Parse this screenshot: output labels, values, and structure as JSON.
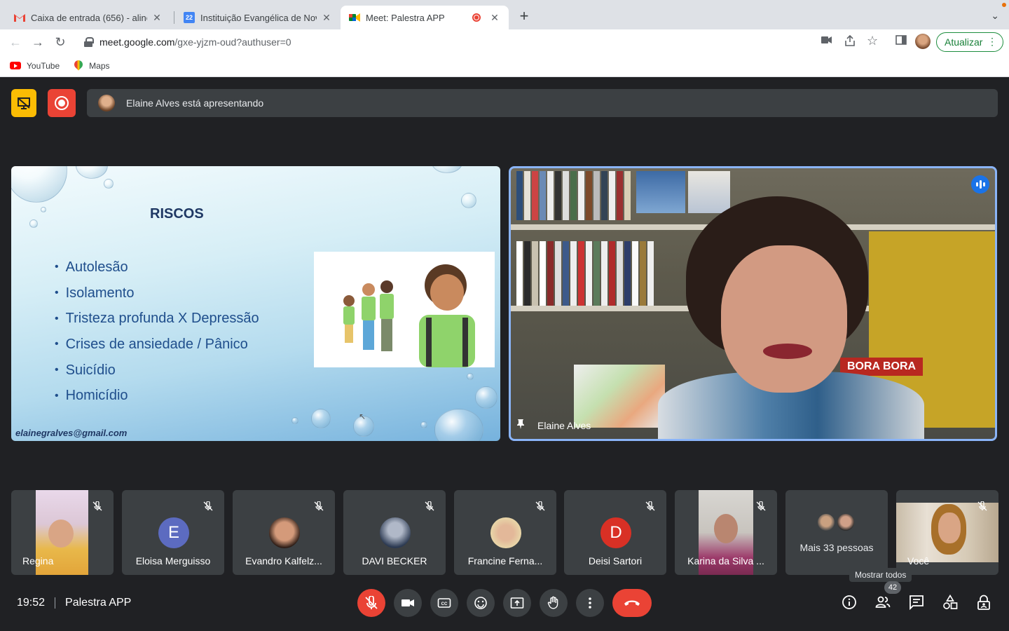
{
  "browser": {
    "tabs": [
      {
        "title": "Caixa de entrada (656) - aline.",
        "favicon": "gmail-icon"
      },
      {
        "title": "Instituição Evangélica de Novo",
        "favicon": "calendar-icon"
      },
      {
        "title": "Meet: Palestra APP",
        "favicon": "meet-icon"
      }
    ],
    "url_host": "meet.google.com",
    "url_path": "/gxe-yjzm-oud?authuser=0",
    "update_label": "Atualizar",
    "bookmarks": [
      {
        "label": "YouTube"
      },
      {
        "label": "Maps"
      }
    ]
  },
  "meet": {
    "presenter_text": "Elaine Alves está apresentando",
    "slide": {
      "title": "RISCOS",
      "items": [
        "Autolesão",
        "Isolamento",
        "Tristeza profunda X Depressão",
        "Crises de ansiedade / Pânico",
        "Suicídio",
        "Homicídio"
      ],
      "footer": "elainegralves@gmail.com"
    },
    "main_video": {
      "name": "Elaine Alves",
      "sign_text": "BORA BORA"
    },
    "participants": [
      {
        "name": "Regina"
      },
      {
        "name": "Eloisa Merguisso",
        "initial": "E"
      },
      {
        "name": "Evandro Kalfelz..."
      },
      {
        "name": "DAVI BECKER"
      },
      {
        "name": "Francine Ferna..."
      },
      {
        "name": "Deisi Sartori",
        "initial": "D"
      },
      {
        "name": "Karina da Silva ..."
      },
      {
        "name": "Mais 33 pessoas"
      },
      {
        "name": "Você"
      }
    ],
    "tooltip": "Mostrar todos",
    "participant_count": "42",
    "time": "19:52",
    "meeting_title": "Palestra APP"
  },
  "colors": {
    "meet_bg": "#202124",
    "tile_bg": "#3c4043",
    "red": "#ea4335",
    "active_speaker_border": "#8ab4f8",
    "update_green": "#188038"
  }
}
